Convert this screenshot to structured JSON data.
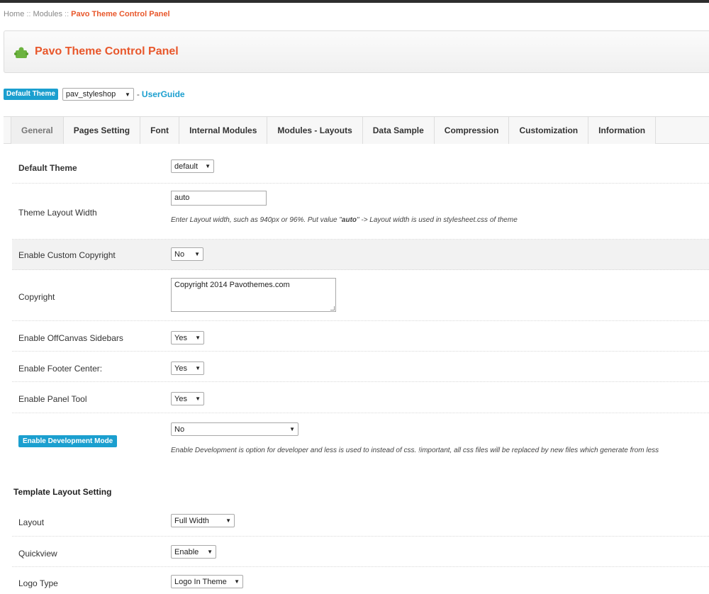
{
  "breadcrumb": {
    "items": [
      "Home",
      "Modules",
      "Pavo Theme Control Panel"
    ],
    "sep": "::"
  },
  "header": {
    "title": "Pavo Theme Control Panel",
    "icon": "puzzle-icon",
    "accent": "#e8572b"
  },
  "theme_bar": {
    "badge": "Default Theme",
    "selected": "pav_styleshop",
    "dash": "-",
    "guide_link": "UserGuide",
    "badge_color": "#1b9fcf"
  },
  "tabs": [
    "General",
    "Pages Setting",
    "Font",
    "Internal Modules",
    "Modules - Layouts",
    "Data Sample",
    "Compression",
    "Customization",
    "Information"
  ],
  "general": {
    "default_theme": {
      "label": "Default Theme",
      "value": "default"
    },
    "layout_width": {
      "label": "Theme Layout Width",
      "value": "auto",
      "hint_pre": "Enter Layout width, such as 940px or 96%. Put value \"",
      "hint_bold": "auto",
      "hint_post": "\" -> Layout width is used in stylesheet.css of theme"
    },
    "custom_copyright": {
      "label": "Enable Custom Copyright",
      "value": "No"
    },
    "copyright": {
      "label": "Copyright",
      "value": "Copyright 2014 Pavothemes.com"
    },
    "offcanvas": {
      "label": "Enable OffCanvas Sidebars",
      "value": "Yes"
    },
    "footer_center": {
      "label": "Enable Footer Center:",
      "value": "Yes"
    },
    "panel_tool": {
      "label": "Enable Panel Tool",
      "value": "Yes"
    },
    "dev_mode": {
      "label": "Enable Development Mode",
      "value": "No",
      "hint": "Enable Development is option for developer and less is used to instead of css. !important, all css files will be replaced by new files which generate from less"
    }
  },
  "template_layout": {
    "title": "Template Layout Setting",
    "layout": {
      "label": "Layout",
      "value": "Full Width"
    },
    "quickview": {
      "label": "Quickview",
      "value": "Enable"
    },
    "logo_type": {
      "label": "Logo Type",
      "value": "Logo In Theme"
    }
  }
}
